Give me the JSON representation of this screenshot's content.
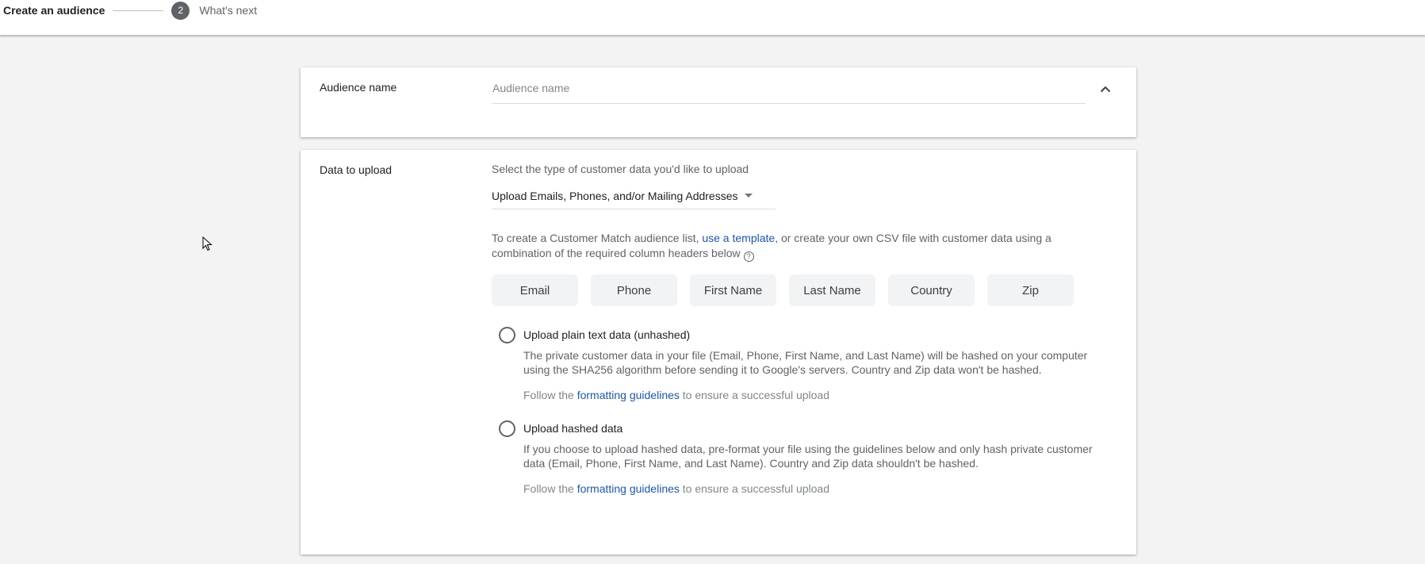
{
  "stepper": {
    "step1_label": "Create an audience",
    "step2_number": "2",
    "step2_label": "What's next"
  },
  "audience_name_section": {
    "label": "Audience name",
    "input_value": "",
    "input_placeholder": "Audience name",
    "collapse_icon": "chevron-up-icon"
  },
  "data_upload_section": {
    "label": "Data to upload",
    "hint": "Select the type of customer data you'd like to upload",
    "dropdown_selected": "Upload Emails, Phones, and/or Mailing Addresses",
    "description_prefix": "To create a Customer Match audience list, ",
    "description_link": "use a template",
    "description_suffix": ", or create your own CSV file with customer data using a combination of the required column headers below",
    "help_icon_glyph": "?",
    "column_headers": [
      "Email",
      "Phone",
      "First Name",
      "Last Name",
      "Country",
      "Zip"
    ],
    "options": [
      {
        "title": "Upload plain text data (unhashed)",
        "selected": false,
        "body": "The private customer data in your file (Email, Phone, First Name, and Last Name) will be hashed on your computer using the SHA256 algorithm before sending it to Google's servers. Country and Zip data won't be hashed.",
        "footer_prefix": "Follow the ",
        "footer_link": "formatting guidelines",
        "footer_suffix": " to ensure a successful upload"
      },
      {
        "title": "Upload hashed data",
        "selected": false,
        "body": "If you choose to upload hashed data, pre-format your file using the guidelines below and only hash private customer data (Email, Phone, First Name, and Last Name). Country and Zip data shouldn't be hashed.",
        "footer_prefix": "Follow the ",
        "footer_link": "formatting guidelines",
        "footer_suffix": " to ensure a successful upload"
      }
    ]
  },
  "colors": {
    "page_background": "#f3f3f3",
    "link": "#1a56b8",
    "step_badge": "#5f6368",
    "chip_background": "#f1f3f4"
  }
}
